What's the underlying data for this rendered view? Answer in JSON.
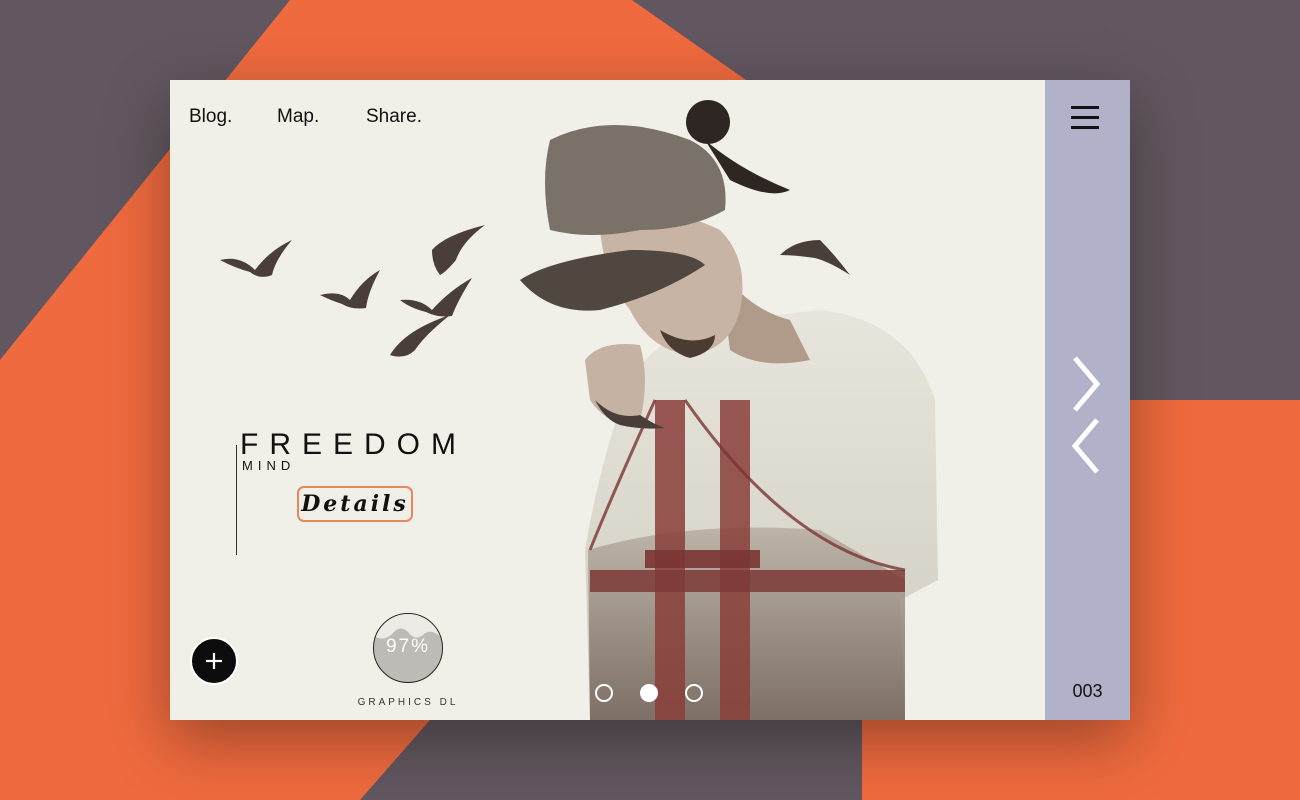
{
  "nav": {
    "links": [
      {
        "label": "Blog."
      },
      {
        "label": "Map."
      },
      {
        "label": "Share."
      }
    ]
  },
  "hero": {
    "headline": "FREEDOM",
    "subheadline": "MIND",
    "details_label": "Details",
    "image_name": "man-golden-gate-double-exposure"
  },
  "badge": {
    "progress_percent": 97,
    "progress_label": "97%",
    "caption": "GRAPHICS DL"
  },
  "carousel": {
    "dots": 3,
    "active_index": 1
  },
  "sidebar": {
    "slide_counter": "003",
    "icons": [
      "menu-icon",
      "chevron-right-icon",
      "chevron-left-icon"
    ]
  },
  "actions": {
    "add_icon": "plus-icon"
  },
  "colors": {
    "background_dark": "#625760",
    "background_orange": "#ef6a3e",
    "card": "#f1f0e8",
    "sidebar": "#b2b1ca",
    "details_border": "#e6885c"
  }
}
